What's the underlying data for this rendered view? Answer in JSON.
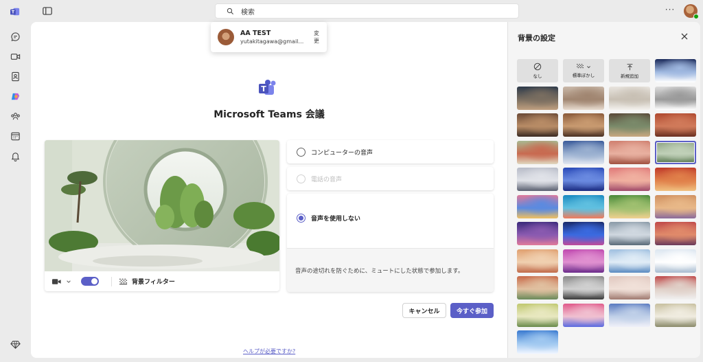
{
  "rail": {
    "apps": [
      "chat-icon",
      "calendar-video-icon",
      "contacts-icon",
      "copilot-icon",
      "communities-icon",
      "calendar-icon",
      "bell-icon"
    ],
    "bottom": "premium-diamond-icon"
  },
  "topbar": {
    "search_placeholder": "検索",
    "more_label": "···"
  },
  "account": {
    "name": "AA TEST",
    "email": "yutakitagawa@gmail....",
    "change_label": "変更"
  },
  "meeting": {
    "title": "Microsoft Teams 会議"
  },
  "controls": {
    "video_on": true,
    "background_filter_label": "背景フィルター"
  },
  "audio": {
    "options": [
      {
        "label": "コンピューターの音声",
        "state": "unchecked"
      },
      {
        "label": "電話の音声",
        "state": "disabled"
      },
      {
        "label": "音声を使用しない",
        "state": "checked"
      }
    ],
    "note": "音声の途切れを防ぐために、ミュートにした状態で参加します。"
  },
  "actions": {
    "cancel_label": "キャンセル",
    "join_label": "今すぐ参加"
  },
  "help_link": "ヘルプが必要ですか?",
  "background_panel": {
    "title": "背景の設定",
    "actions": [
      {
        "label": "なし",
        "icon": "none-icon"
      },
      {
        "label": "標準ぼかし",
        "icon": "blur-icon"
      },
      {
        "label": "新規追加",
        "icon": "upload-icon"
      }
    ],
    "tiles": [
      {
        "name": "bg-space-station",
        "colors": [
          "#1b2a5a",
          "#9fb8e0",
          "#ffffff"
        ]
      },
      {
        "name": "bg-landscape-dusk",
        "colors": [
          "#2d3a4a",
          "#7a6e60",
          "#c0a080"
        ]
      },
      {
        "name": "bg-room-arches",
        "colors": [
          "#c9b8a8",
          "#a08570",
          "#e8dcd0"
        ]
      },
      {
        "name": "bg-white-room",
        "colors": [
          "#e8e4de",
          "#c8c0b4",
          "#f4f2ee"
        ]
      },
      {
        "name": "bg-modern-lounge",
        "colors": [
          "#dcdcdc",
          "#9a9a9a",
          "#ffffff"
        ]
      },
      {
        "name": "bg-living-room",
        "colors": [
          "#6b4a36",
          "#b88c66",
          "#3a2a22"
        ]
      },
      {
        "name": "bg-wood-interior",
        "colors": [
          "#8a5a3a",
          "#c89a70",
          "#4a3022"
        ]
      },
      {
        "name": "bg-glass-house",
        "colors": [
          "#5a4a3a",
          "#7a8a6a",
          "#c8a880"
        ]
      },
      {
        "name": "bg-terracotta-room",
        "colors": [
          "#b04a30",
          "#d07a5a",
          "#6a3020"
        ]
      },
      {
        "name": "bg-green-arch",
        "colors": [
          "#a8b890",
          "#c86a50",
          "#e0d8c0"
        ]
      },
      {
        "name": "bg-blue-balcony",
        "colors": [
          "#3a5a9a",
          "#9ab0d0",
          "#e0e6f0"
        ]
      },
      {
        "name": "bg-pink-arch",
        "colors": [
          "#d08070",
          "#e8b0a0",
          "#a05040"
        ]
      },
      {
        "name": "bg-circle-garden",
        "colors": [
          "#8aa080",
          "#c0d0b8",
          "#4a6a40"
        ]
      },
      {
        "name": "bg-white-dome",
        "colors": [
          "#b8bcc8",
          "#e0e2e8",
          "#5a6070"
        ]
      },
      {
        "name": "bg-blue-window",
        "colors": [
          "#2a4ab8",
          "#6a8ae0",
          "#1a2a80"
        ]
      },
      {
        "name": "bg-pink-columns",
        "colors": [
          "#e07a7a",
          "#f0b0a0",
          "#a04a6a"
        ]
      },
      {
        "name": "bg-autumn-forest",
        "colors": [
          "#c03a2a",
          "#e0804a",
          "#f0c080"
        ]
      },
      {
        "name": "bg-coral-reef",
        "colors": [
          "#e07a9a",
          "#5a8ae0",
          "#f0c060"
        ]
      },
      {
        "name": "bg-underwater",
        "colors": [
          "#1a8ac0",
          "#60c0e0",
          "#f07a5a"
        ]
      },
      {
        "name": "bg-green-hills",
        "colors": [
          "#4a8a3a",
          "#a0c070",
          "#f0d090"
        ]
      },
      {
        "name": "bg-desert-dunes",
        "colors": [
          "#d09060",
          "#e8b888",
          "#8a6a9a"
        ]
      },
      {
        "name": "bg-purple-mountains",
        "colors": [
          "#3a2a7a",
          "#8a5ab0",
          "#e07a9a"
        ]
      },
      {
        "name": "bg-night-galaxy",
        "colors": [
          "#1a2a6a",
          "#3a6ae0",
          "#c04a9a"
        ]
      },
      {
        "name": "bg-cloud-sea",
        "colors": [
          "#8a9aa8",
          "#d0d8e0",
          "#5a6a78"
        ]
      },
      {
        "name": "bg-red-sky",
        "colors": [
          "#c04a4a",
          "#e08a6a",
          "#6a3a5a"
        ]
      },
      {
        "name": "bg-abstract-orange",
        "colors": [
          "#e0a070",
          "#f0d0b0",
          "#c06a4a"
        ]
      },
      {
        "name": "bg-pink-flowers",
        "colors": [
          "#c04ab0",
          "#e090d0",
          "#6a2a8a"
        ]
      },
      {
        "name": "bg-ice-waves",
        "colors": [
          "#a0c0e0",
          "#e0ecf6",
          "#5a8ac0"
        ]
      },
      {
        "name": "bg-white-waves",
        "colors": [
          "#dce6f0",
          "#ffffff",
          "#a8bcd0"
        ]
      },
      {
        "name": "bg-shell-colors",
        "colors": [
          "#c86a4a",
          "#e0c0a0",
          "#6a8a5a"
        ]
      },
      {
        "name": "bg-marble-gray",
        "colors": [
          "#8a8a8a",
          "#d0d0d0",
          "#3a3a3a"
        ]
      },
      {
        "name": "bg-spheres",
        "colors": [
          "#e0c8c0",
          "#f0e0d8",
          "#a07a70"
        ]
      },
      {
        "name": "bg-red-swirl",
        "colors": [
          "#c04a4a",
          "#e0d0c8",
          "#f0f0f0"
        ]
      },
      {
        "name": "bg-green-circle",
        "colors": [
          "#c0c870",
          "#e8e8c0",
          "#6a8a4a"
        ]
      },
      {
        "name": "bg-ribbon-pink",
        "colors": [
          "#e05a8a",
          "#f0c0d0",
          "#5a6ae0"
        ]
      },
      {
        "name": "bg-blue-flow",
        "colors": [
          "#5a7ac0",
          "#c0d0e8",
          "#f0f0f8"
        ]
      },
      {
        "name": "bg-cream-tunnel",
        "colors": [
          "#c8c0a0",
          "#f0ece0",
          "#8a8a6a"
        ]
      },
      {
        "name": "bg-blue-rings",
        "colors": [
          "#3a7ad0",
          "#a0c8f0",
          "#f0f6ff"
        ]
      }
    ],
    "selected_index": 12
  }
}
